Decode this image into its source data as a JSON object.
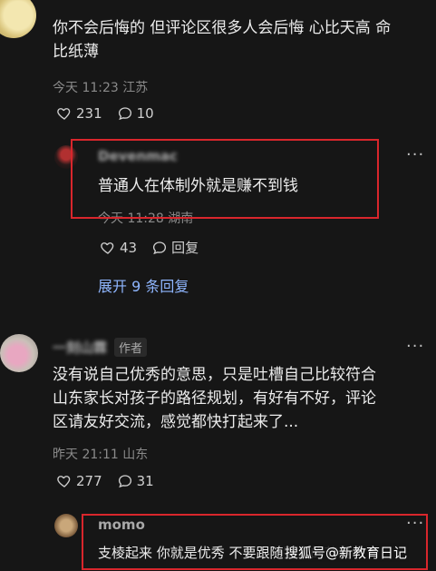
{
  "comment1": {
    "text_line1": "你不会后悔的 但评论区很多人会后悔 心比天高 命",
    "text_line2": "比纸薄",
    "time": "今天 11:23 江苏",
    "likes": "231",
    "replies": "10"
  },
  "reply1": {
    "name": "Devenmac",
    "text": "普通人在体制外就是赚不到钱",
    "time": "今天 11:28 湖南",
    "likes": "43",
    "reply_label": "回复"
  },
  "expand_replies": "展开 9 条回复",
  "comment2": {
    "name": "一刻山霖",
    "author_tag": "作者",
    "line1": "没有说自己优秀的意思，只是吐槽自己比较符合",
    "line2": "山东家长对孩子的路径规划，有好有不好，评论",
    "line3": "区请友好交流，感觉都快打起来了...",
    "time": "昨天 21:11 山东",
    "likes": "277",
    "replies": "31"
  },
  "reply2": {
    "name": "momo",
    "text": "支棱起来 你就是优秀 不要跟随别人的节奏",
    "watermark": "搜狐号@新教育日记"
  },
  "more_label": "···",
  "colors": {
    "highlight": "#d9262c",
    "link": "#8fb6ff",
    "bg": "#161616"
  },
  "icons": [
    "heart-icon",
    "comment-icon",
    "more-icon"
  ]
}
